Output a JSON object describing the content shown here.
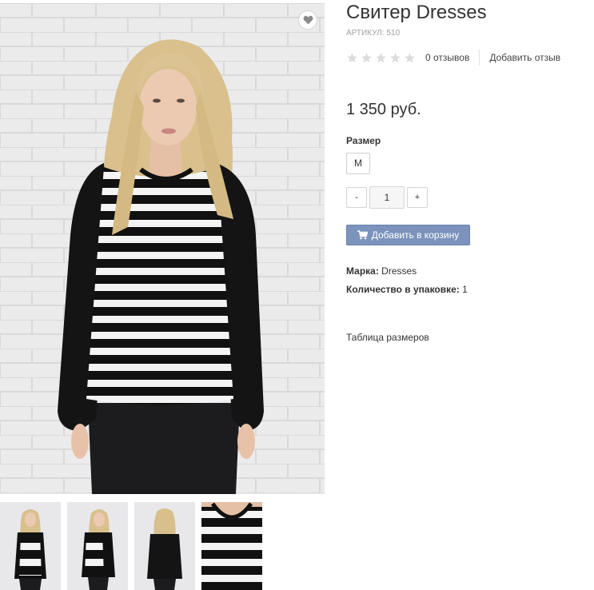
{
  "product": {
    "title": "Свитер Dresses",
    "sku_label": "АРТИКУЛ:",
    "sku_value": "510",
    "rating": 0,
    "reviews_count": "0 отзывов",
    "add_review": "Добавить отзыв",
    "price": "1 350 руб."
  },
  "options": {
    "size_label": "Размер",
    "size_value": "M"
  },
  "quantity": {
    "minus": "-",
    "value": "1",
    "plus": "+"
  },
  "cart": {
    "label": "Добавить в корзину"
  },
  "properties": [
    {
      "key": "Марка:",
      "value": "Dresses"
    },
    {
      "key": "Количество в упаковке:",
      "value": "1"
    }
  ],
  "size_table_link": "Таблица размеров",
  "colors": {
    "accent_button": "#7b93bd",
    "star_inactive": "#dcdcdc",
    "sku_text": "#a0a0a0"
  },
  "icons": {
    "wishlist": "heart-icon",
    "cart": "cart-icon",
    "rating": "star-icon"
  }
}
